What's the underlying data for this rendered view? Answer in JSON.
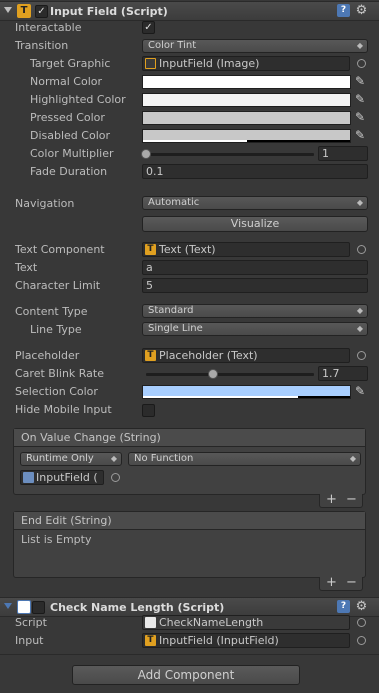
{
  "input_field": {
    "title": "Input Field (Script)",
    "enabled_check": "✓",
    "interactable_label": "Interactable",
    "interactable_check": "✓",
    "transition_label": "Transition",
    "transition_value": "Color Tint",
    "target_graphic_label": "Target Graphic",
    "target_graphic_value": "InputField (Image)",
    "normal_color_label": "Normal Color",
    "highlighted_color_label": "Highlighted Color",
    "pressed_color_label": "Pressed Color",
    "disabled_color_label": "Disabled Color",
    "color_multiplier_label": "Color Multiplier",
    "color_multiplier_value": "1",
    "color_multiplier_fraction": 0,
    "fade_duration_label": "Fade Duration",
    "fade_duration_value": "0.1",
    "navigation_label": "Navigation",
    "navigation_value": "Automatic",
    "visualize_label": "Visualize",
    "text_component_label": "Text Component",
    "text_component_value": "Text (Text)",
    "text_label": "Text",
    "text_value": "a",
    "character_limit_label": "Character Limit",
    "character_limit_value": "5",
    "content_type_label": "Content Type",
    "content_type_value": "Standard",
    "line_type_label": "Line Type",
    "line_type_value": "Single Line",
    "placeholder_label": "Placeholder",
    "placeholder_value": "Placeholder (Text)",
    "caret_blink_label": "Caret Blink Rate",
    "caret_blink_value": "1.7",
    "caret_blink_fraction": 0.425,
    "selection_color_label": "Selection Color",
    "hide_mobile_label": "Hide Mobile Input"
  },
  "colors": {
    "normal": "#ffffff",
    "highlighted": "#f5f5f5",
    "pressed": "#c8c8c8",
    "disabled": "#c8c8c8",
    "selection": "#a8cefe"
  },
  "on_value_change": {
    "title": "On Value Change (String)",
    "runtime_value": "Runtime Only",
    "function_value": "No Function",
    "object_value": "InputField (",
    "plus": "+",
    "minus": "−"
  },
  "end_edit": {
    "title": "End Edit (String)",
    "empty_text": "List is Empty",
    "plus": "+",
    "minus": "−"
  },
  "check_name": {
    "title": "Check Name Length (Script)",
    "script_label": "Script",
    "script_value": "CheckNameLength",
    "input_label": "Input",
    "input_value": "InputField (InputField)"
  },
  "add_component_label": "Add Component",
  "icons": {
    "script_T": "T",
    "help": "?",
    "gear": "⚙",
    "eyedropper": "✎",
    "dropdown_arrow": "◆"
  }
}
